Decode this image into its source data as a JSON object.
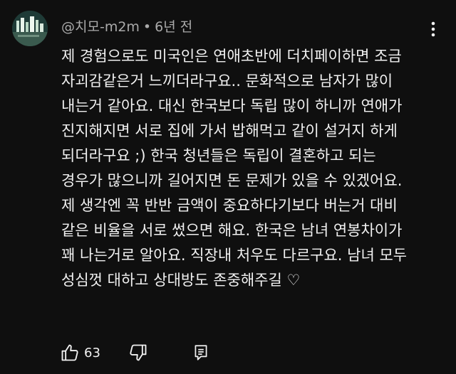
{
  "comment": {
    "author": "@치모-m2m",
    "separator": "•",
    "time": "6년 전",
    "lines": [
      "제 경험으로도 미국인은 연애초반에 더치페이하면 조금",
      "자괴감같은거 느끼더라구요.. 문화적으로 남자가 많이",
      "내는거 같아요. 대신 한국보다 독립 많이 하니까 연애가",
      "진지해지면 서로 집에 가서 밥해먹고 같이 설거지 하게",
      "되더라구요 ;) 한국 청년들은 독립이 결혼하고 되는",
      "경우가 많으니까 길어지면 돈 문제가 있을 수 있겠어요.",
      "제 생각엔 꼭 반반 금액이 중요하다기보다 버는거 대비",
      "같은 비율을 서로 썼으면 해요. 한국은 남녀 연봉차이가",
      "꽤 나는거로 알아요. 직장내 처우도 다르구요. 남녀 모두",
      "성심껏 대하고 상대방도 존중해주길 ♡"
    ],
    "like_count": "63"
  },
  "icons": {
    "avatar": "avatar-image",
    "menu": "more-vert-icon",
    "like": "thumb-up-icon",
    "dislike": "thumb-down-icon",
    "reply": "reply-comment-icon"
  },
  "colors": {
    "background": "#0f0f0f",
    "text": "#f1f1f1",
    "secondary_text": "#aaaaaa"
  }
}
